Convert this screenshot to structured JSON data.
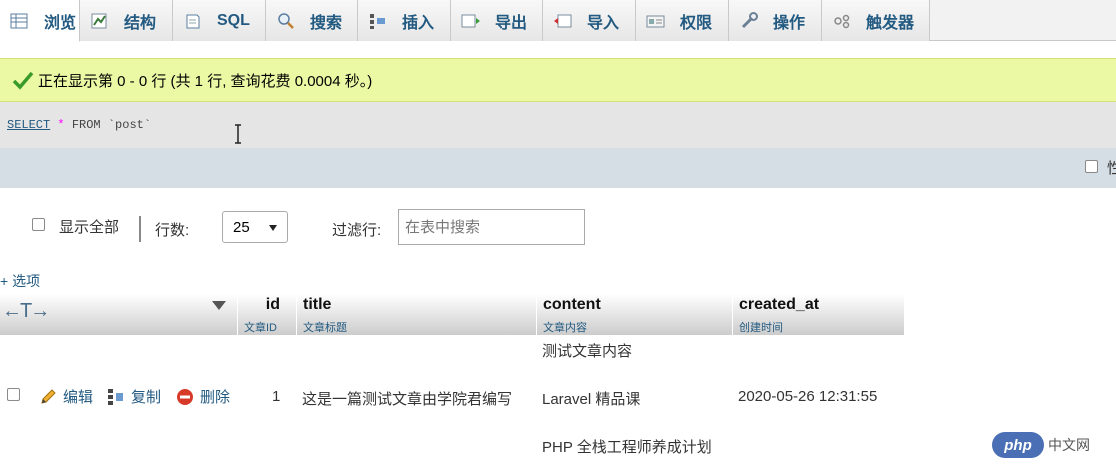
{
  "tabs": [
    {
      "label": "浏览",
      "icon": "browse-icon",
      "active": true
    },
    {
      "label": "结构",
      "icon": "structure-icon"
    },
    {
      "label": "SQL",
      "icon": "sql-icon"
    },
    {
      "label": "搜索",
      "icon": "search-icon"
    },
    {
      "label": "插入",
      "icon": "insert-icon"
    },
    {
      "label": "导出",
      "icon": "export-icon"
    },
    {
      "label": "导入",
      "icon": "import-icon"
    },
    {
      "label": "权限",
      "icon": "privileges-icon"
    },
    {
      "label": "操作",
      "icon": "wrench-icon"
    },
    {
      "label": "触发器",
      "icon": "triggers-icon"
    }
  ],
  "status": {
    "message": "正在显示第 0 - 0 行 (共 1 行, 查询花费 0.0004 秒。)",
    "color": "#ebf8a4"
  },
  "sql": {
    "keyword": "SELECT",
    "star": "*",
    "rest": "FROM `post`"
  },
  "profiling": {
    "label": "性"
  },
  "navigation": {
    "show_all_label": "显示全部",
    "rows_label": "行数:",
    "rows_value": "25",
    "filter_label": "过滤行:",
    "filter_placeholder": "在表中搜索"
  },
  "options_link": "+ 选项",
  "table": {
    "columns": [
      {
        "name": "id",
        "comment": "文章ID"
      },
      {
        "name": "title",
        "comment": "文章标题"
      },
      {
        "name": "content",
        "comment": "文章内容"
      },
      {
        "name": "created_at",
        "comment": "创建时间"
      }
    ],
    "row": {
      "edit_label": "编辑",
      "copy_label": "复制",
      "delete_label": "删除",
      "id": "1",
      "title": "这是一篇测试文章由学院君编写",
      "content_lines": [
        "测试文章内容",
        "Laravel 精品课",
        "PHP 全栈工程师养成计划"
      ],
      "created_at": "2020-05-26 12:31:55"
    }
  },
  "watermark": {
    "logo": "php",
    "text": "中文网"
  },
  "colors": {
    "link": "#235a81",
    "success_bg": "#ebf8a4",
    "header_bar": "#d5dde5"
  }
}
